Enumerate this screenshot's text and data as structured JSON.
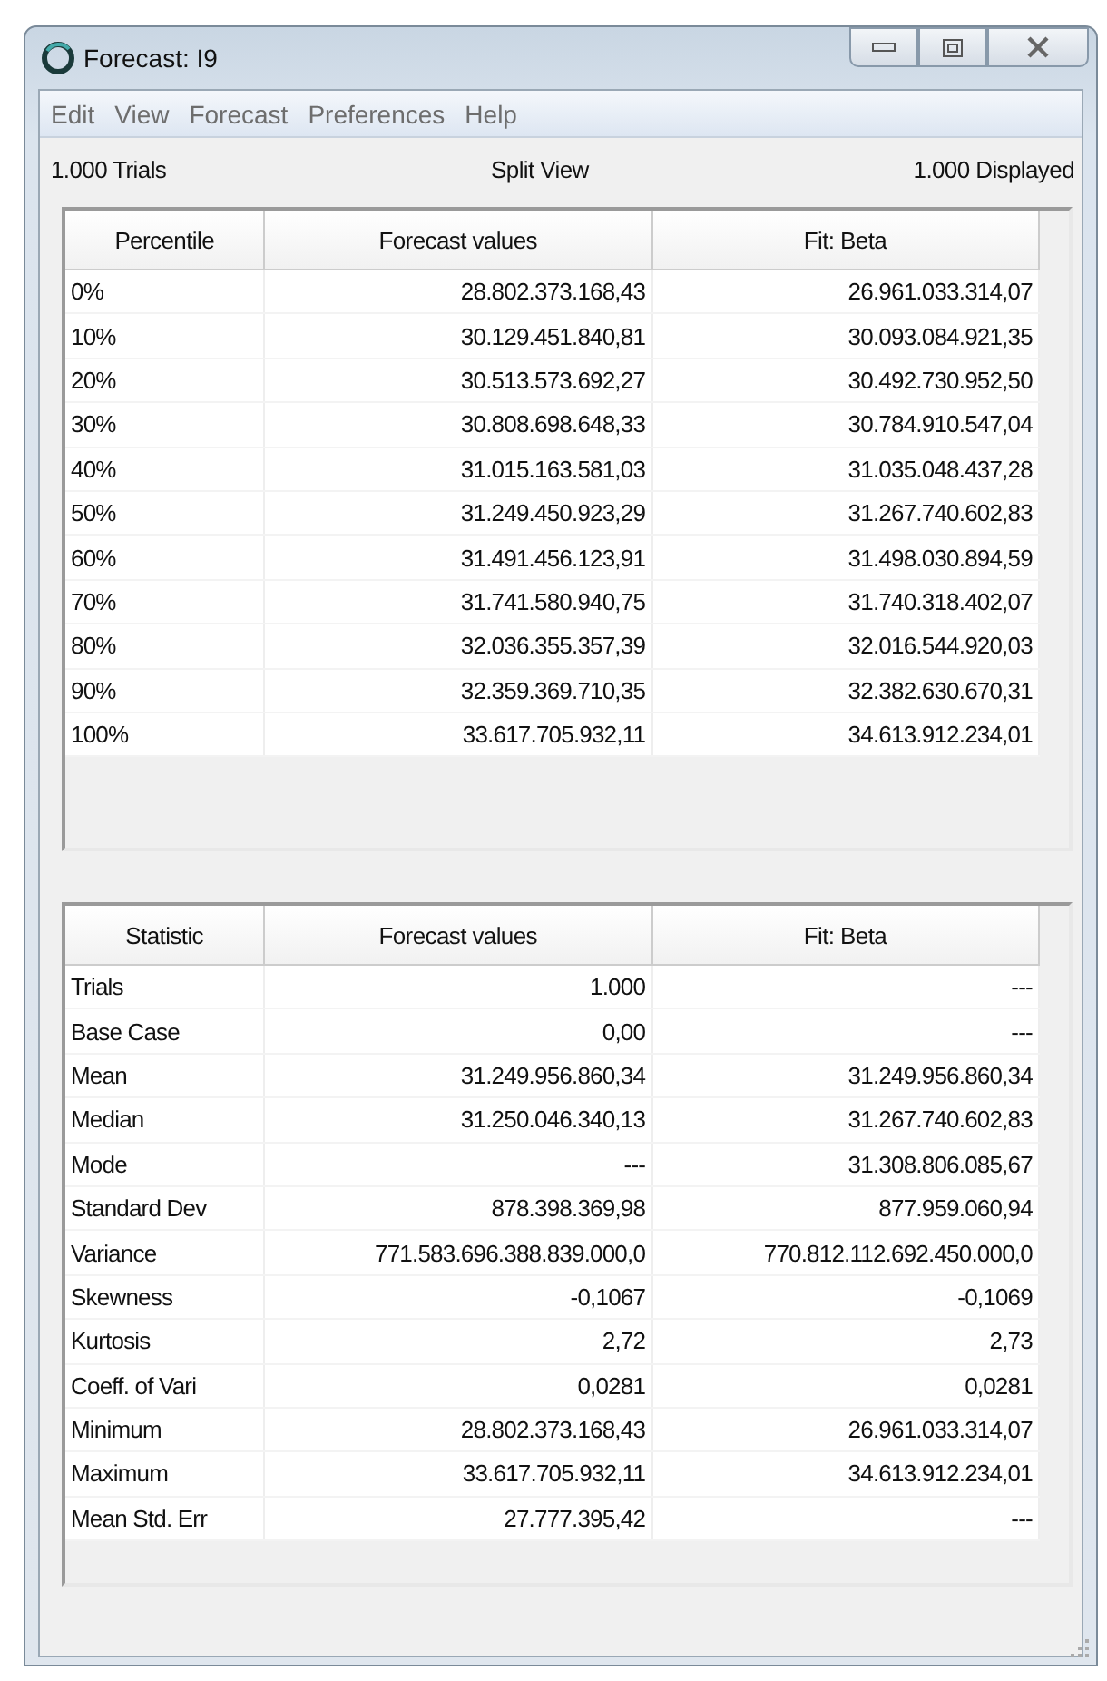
{
  "window": {
    "title": "Forecast: I9"
  },
  "menu": [
    "Edit",
    "View",
    "Forecast",
    "Preferences",
    "Help"
  ],
  "info": {
    "trials": "1.000 Trials",
    "view": "Split View",
    "displayed": "1.000 Displayed"
  },
  "percentile_table": {
    "columns": [
      "Percentile",
      "Forecast values",
      "Fit: Beta"
    ],
    "rows": [
      [
        "0%",
        "28.802.373.168,43",
        "26.961.033.314,07"
      ],
      [
        "10%",
        "30.129.451.840,81",
        "30.093.084.921,35"
      ],
      [
        "20%",
        "30.513.573.692,27",
        "30.492.730.952,50"
      ],
      [
        "30%",
        "30.808.698.648,33",
        "30.784.910.547,04"
      ],
      [
        "40%",
        "31.015.163.581,03",
        "31.035.048.437,28"
      ],
      [
        "50%",
        "31.249.450.923,29",
        "31.267.740.602,83"
      ],
      [
        "60%",
        "31.491.456.123,91",
        "31.498.030.894,59"
      ],
      [
        "70%",
        "31.741.580.940,75",
        "31.740.318.402,07"
      ],
      [
        "80%",
        "32.036.355.357,39",
        "32.016.544.920,03"
      ],
      [
        "90%",
        "32.359.369.710,35",
        "32.382.630.670,31"
      ],
      [
        "100%",
        "33.617.705.932,11",
        "34.613.912.234,01"
      ]
    ]
  },
  "statistics_table": {
    "columns": [
      "Statistic",
      "Forecast values",
      "Fit: Beta"
    ],
    "rows": [
      [
        "Trials",
        "1.000",
        "---"
      ],
      [
        "Base Case",
        "0,00",
        "---"
      ],
      [
        "Mean",
        "31.249.956.860,34",
        "31.249.956.860,34"
      ],
      [
        "Median",
        "31.250.046.340,13",
        "31.267.740.602,83"
      ],
      [
        "Mode",
        "---",
        "31.308.806.085,67"
      ],
      [
        "Standard Dev",
        "878.398.369,98",
        "877.959.060,94"
      ],
      [
        "Variance",
        "771.583.696.388.839.000,0",
        "770.812.112.692.450.000,0"
      ],
      [
        "Skewness",
        "-0,1067",
        "-0,1069"
      ],
      [
        "Kurtosis",
        "2,72",
        "2,73"
      ],
      [
        "Coeff. of Vari",
        "0,0281",
        "0,0281"
      ],
      [
        "Minimum",
        "28.802.373.168,43",
        "26.961.033.314,07"
      ],
      [
        "Maximum",
        "33.617.705.932,11",
        "34.613.912.234,01"
      ],
      [
        "Mean  Std. Err",
        "27.777.395,42",
        "---"
      ]
    ]
  }
}
